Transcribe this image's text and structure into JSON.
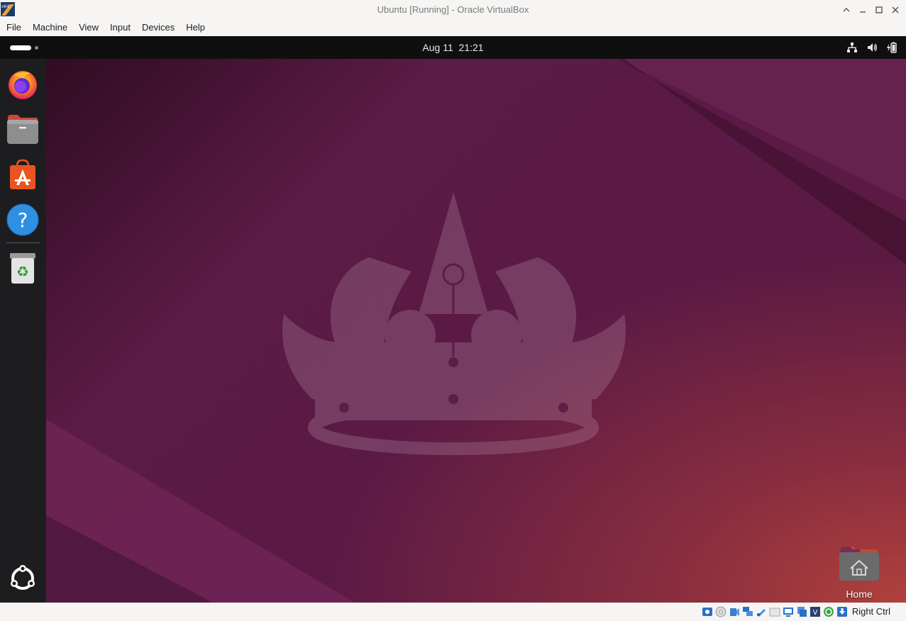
{
  "window": {
    "title": "Ubuntu [Running] - Oracle VirtualBox"
  },
  "menu": [
    "File",
    "Machine",
    "View",
    "Input",
    "Devices",
    "Help"
  ],
  "guest": {
    "topbar": {
      "date": "Aug 11",
      "time": "21:21",
      "tray_icons": [
        "network-icon",
        "volume-icon",
        "battery-icon"
      ]
    },
    "dock": {
      "apps": [
        {
          "name": "Firefox",
          "icon": "firefox-icon"
        },
        {
          "name": "Files",
          "icon": "files-icon"
        },
        {
          "name": "App Center",
          "icon": "app-center-icon"
        },
        {
          "name": "Help",
          "icon": "help-icon"
        },
        {
          "name": "Trash",
          "icon": "trash-icon"
        }
      ],
      "show_apps_icon": "ubuntu-logo-icon"
    },
    "desktop": {
      "home_label": "Home"
    }
  },
  "statusbar": {
    "host_key": "Right Ctrl"
  },
  "colors": {
    "accent": "#e95420",
    "topbar": "#0f0f0f",
    "dock": "#1d1d1f",
    "wallpaper": "#5a1b44"
  }
}
